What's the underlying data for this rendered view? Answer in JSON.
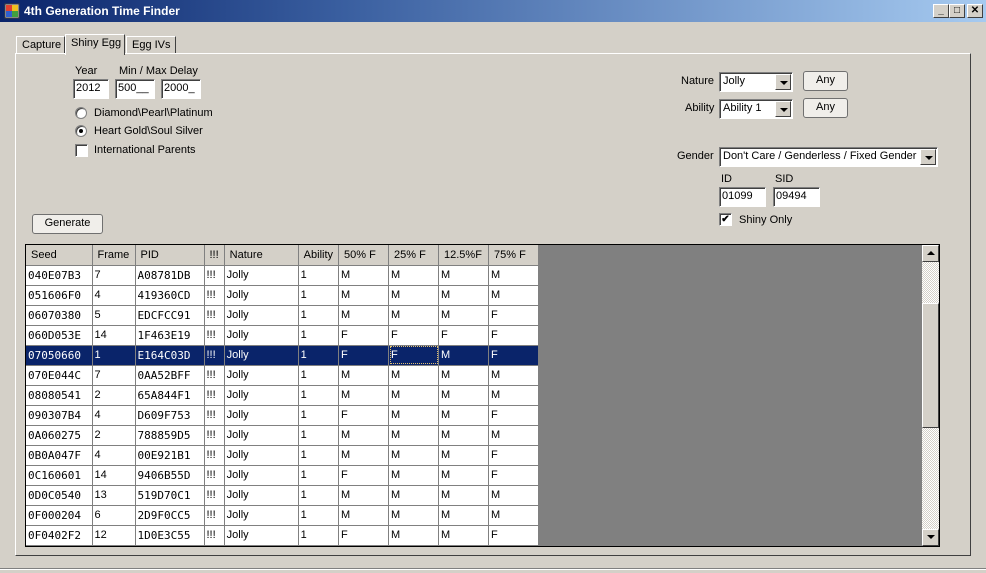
{
  "window": {
    "title": "4th Generation Time Finder",
    "minimize_label": "_",
    "maximize_label": "□",
    "close_label": "✕"
  },
  "tabs": [
    {
      "label": "Capture",
      "active": false
    },
    {
      "label": "Shiny Egg",
      "active": true
    },
    {
      "label": "Egg IVs",
      "active": false
    }
  ],
  "form": {
    "year_label": "Year",
    "year_value": "2012",
    "delay_label": "Min / Max Delay",
    "min_delay_value": "500__",
    "max_delay_value": "2000_",
    "games": [
      {
        "label": "Diamond\\Pearl\\Platinum",
        "checked": false
      },
      {
        "label": "Heart Gold\\Soul Silver",
        "checked": true
      }
    ],
    "international_parents_label": "International Parents",
    "international_parents_checked": false,
    "generate_label": "Generate",
    "nature_label": "Nature",
    "nature_value": "Jolly",
    "nature_any_label": "Any",
    "ability_label": "Ability",
    "ability_value": "Ability 1",
    "ability_any_label": "Any",
    "gender_label": "Gender",
    "gender_value": "Don't Care / Genderless / Fixed Gender",
    "id_label": "ID",
    "id_value": "01099",
    "sid_label": "SID",
    "sid_value": "09494",
    "shiny_only_label": "Shiny Only",
    "shiny_only_checked": true,
    "check_mark": "✔"
  },
  "grid": {
    "columns": [
      "Seed",
      "Frame",
      "PID",
      "!!!",
      "Nature",
      "Ability",
      "50% F",
      "25% F",
      "12.5%F",
      "75% F"
    ],
    "selected_row": 4,
    "rows": [
      [
        "040E07B3",
        "7",
        "A08781DB",
        "!!!",
        "Jolly",
        "1",
        "M",
        "M",
        "M",
        "M"
      ],
      [
        "051606F0",
        "4",
        "419360CD",
        "!!!",
        "Jolly",
        "1",
        "M",
        "M",
        "M",
        "M"
      ],
      [
        "06070380",
        "5",
        "EDCFCC91",
        "!!!",
        "Jolly",
        "1",
        "M",
        "M",
        "M",
        "F"
      ],
      [
        "060D053E",
        "14",
        "1F463E19",
        "!!!",
        "Jolly",
        "1",
        "F",
        "F",
        "F",
        "F"
      ],
      [
        "07050660",
        "1",
        "E164C03D",
        "!!!",
        "Jolly",
        "1",
        "F",
        "F",
        "M",
        "F"
      ],
      [
        "070E044C",
        "7",
        "0AA52BFF",
        "!!!",
        "Jolly",
        "1",
        "M",
        "M",
        "M",
        "M"
      ],
      [
        "08080541",
        "2",
        "65A844F1",
        "!!!",
        "Jolly",
        "1",
        "M",
        "M",
        "M",
        "M"
      ],
      [
        "090307B4",
        "4",
        "D609F753",
        "!!!",
        "Jolly",
        "1",
        "F",
        "M",
        "M",
        "F"
      ],
      [
        "0A060275",
        "2",
        "788859D5",
        "!!!",
        "Jolly",
        "1",
        "M",
        "M",
        "M",
        "M"
      ],
      [
        "0B0A047F",
        "4",
        "00E921B1",
        "!!!",
        "Jolly",
        "1",
        "M",
        "M",
        "M",
        "F"
      ],
      [
        "0C160601",
        "14",
        "9406B55D",
        "!!!",
        "Jolly",
        "1",
        "F",
        "M",
        "M",
        "F"
      ],
      [
        "0D0C0540",
        "13",
        "519D70C1",
        "!!!",
        "Jolly",
        "1",
        "M",
        "M",
        "M",
        "M"
      ],
      [
        "0F000204",
        "6",
        "2D9F0CC5",
        "!!!",
        "Jolly",
        "1",
        "M",
        "M",
        "M",
        "M"
      ],
      [
        "0F0402F2",
        "12",
        "1D0E3C55",
        "!!!",
        "Jolly",
        "1",
        "F",
        "M",
        "M",
        "F"
      ]
    ]
  },
  "colors": {
    "selection": "#0a246a",
    "grid_background": "#808080",
    "face": "#d4d0c8"
  }
}
